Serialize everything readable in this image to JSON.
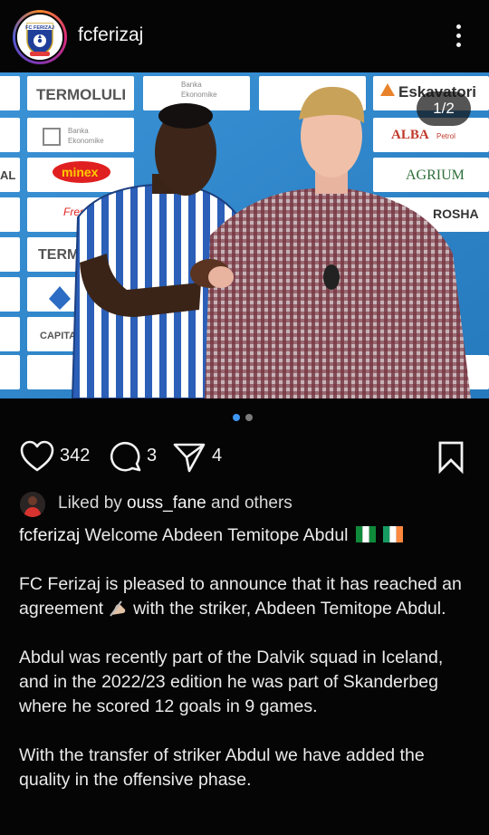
{
  "header": {
    "username": "fcferizaj",
    "avatar_icon": "fc-ferizaj-crest-icon",
    "more_icon": "more-vertical-icon"
  },
  "post": {
    "image_counter": "1/2",
    "image_alt": "Two men shaking hands in front of a sponsor backdrop",
    "sponsors": [
      "TERMOLULI",
      "Banka Ekonomike",
      "Eskavatori",
      "ALBA Petrol",
      "AGRIUM",
      "minex",
      "ROSHA",
      "TERM",
      "CAPITAL"
    ],
    "carousel": {
      "current": 1,
      "total": 2
    }
  },
  "actions": {
    "likes": "342",
    "comments": "3",
    "shares": "4"
  },
  "liked_by": {
    "prefix": "Liked by ",
    "user": "ouss_fane",
    "suffix": " and others"
  },
  "caption": {
    "user": "fcferizaj",
    "headline": "Welcome Abdeen Temitope Abdul",
    "p1_a": "FC Ferizaj is pleased to announce that it has reached an agreement",
    "p1_b": " with the striker, Abdeen Temitope Abdul.",
    "p2": "Abdul was recently part of the Dalvik squad in Iceland, and in the 2022/23 edition he was part of Skanderbeg where he scored 12 goals in 9 games.",
    "p3": "With the transfer of striker Abdul we have added the quality in the offensive phase."
  },
  "colors": {
    "background": "#050505",
    "dot_active": "#3f97f5",
    "dot_inactive": "#7a7a7a"
  }
}
